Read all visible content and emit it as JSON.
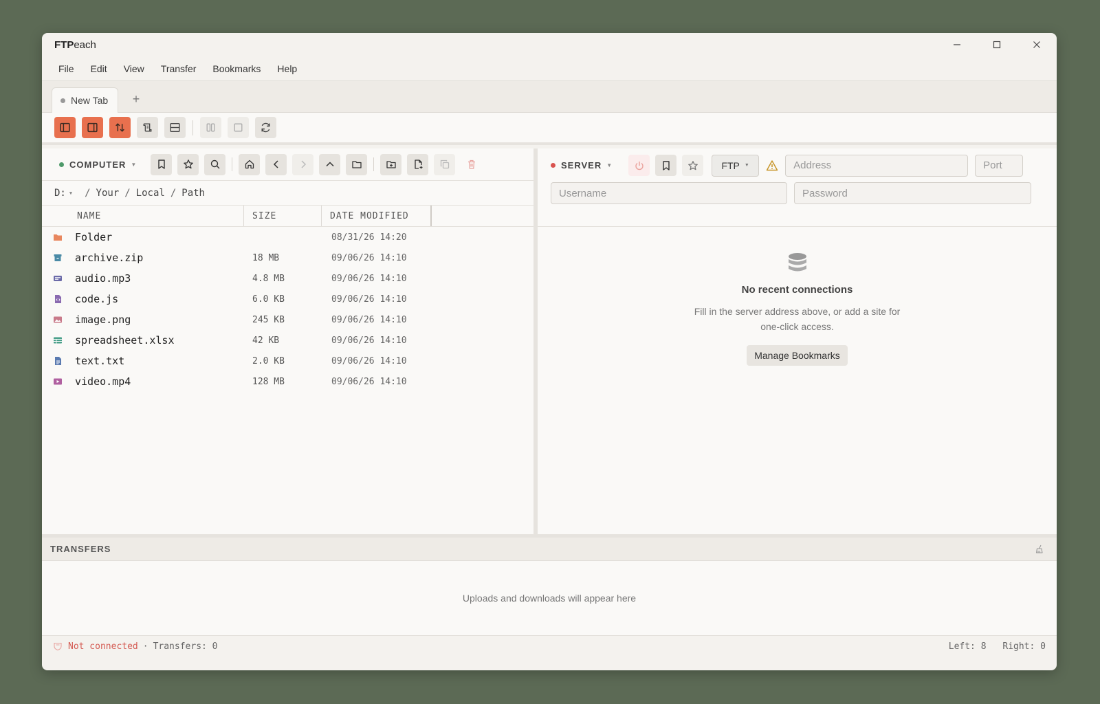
{
  "app": {
    "title_bold": "FTP",
    "title_rest": "each"
  },
  "menu": [
    "File",
    "Edit",
    "View",
    "Transfer",
    "Bookmarks",
    "Help"
  ],
  "tabs": [
    {
      "label": "New Tab"
    }
  ],
  "tab_add": "+",
  "local": {
    "label": "COMPUTER",
    "status_color": "#4e9a6a",
    "drive": "D:",
    "path": [
      "Your",
      "Local",
      "Path"
    ],
    "path_sep": "/",
    "columns": [
      "NAME",
      "SIZE",
      "DATE MODIFIED"
    ],
    "files": [
      {
        "name": "Folder",
        "size": "",
        "date": "08/31/26 14:20",
        "icon": "folder-icon",
        "color": "#e8875e"
      },
      {
        "name": "archive.zip",
        "size": "18 MB",
        "date": "09/06/26 14:10",
        "icon": "archive-icon",
        "color": "#4a8aa6"
      },
      {
        "name": "audio.mp3",
        "size": "4.8 MB",
        "date": "09/06/26 14:10",
        "icon": "audio-icon",
        "color": "#6b6aa8"
      },
      {
        "name": "code.js",
        "size": "6.0 KB",
        "date": "09/06/26 14:10",
        "icon": "code-icon",
        "color": "#8a6ab0"
      },
      {
        "name": "image.png",
        "size": "245 KB",
        "date": "09/06/26 14:10",
        "icon": "image-icon",
        "color": "#c97a8a"
      },
      {
        "name": "spreadsheet.xlsx",
        "size": "42 KB",
        "date": "09/06/26 14:10",
        "icon": "spreadsheet-icon",
        "color": "#4aa08a"
      },
      {
        "name": "text.txt",
        "size": "2.0 KB",
        "date": "09/06/26 14:10",
        "icon": "text-file-icon",
        "color": "#5a7ab0"
      },
      {
        "name": "video.mp4",
        "size": "128 MB",
        "date": "09/06/26 14:10",
        "icon": "video-icon",
        "color": "#b060a0"
      }
    ]
  },
  "remote": {
    "label": "SERVER",
    "status_color": "#d9534f",
    "protocol": "FTP",
    "placeholders": {
      "address": "Address",
      "port": "Port",
      "username": "Username",
      "password": "Password"
    },
    "empty_title": "No recent connections",
    "empty_desc_1": "Fill in the server address above, or add a site for",
    "empty_desc_2": "one-click access.",
    "bookmarks_button": "Manage Bookmarks"
  },
  "transfers": {
    "title": "TRANSFERS",
    "empty": "Uploads and downloads will appear here"
  },
  "status": {
    "connection": "Not connected",
    "sep": "·",
    "transfers": "Transfers: 0",
    "left": "Left: 8",
    "right": "Right: 0"
  },
  "colors": {
    "accent": "#e8704e",
    "danger": "#d45a52",
    "warning": "#c8962a"
  }
}
